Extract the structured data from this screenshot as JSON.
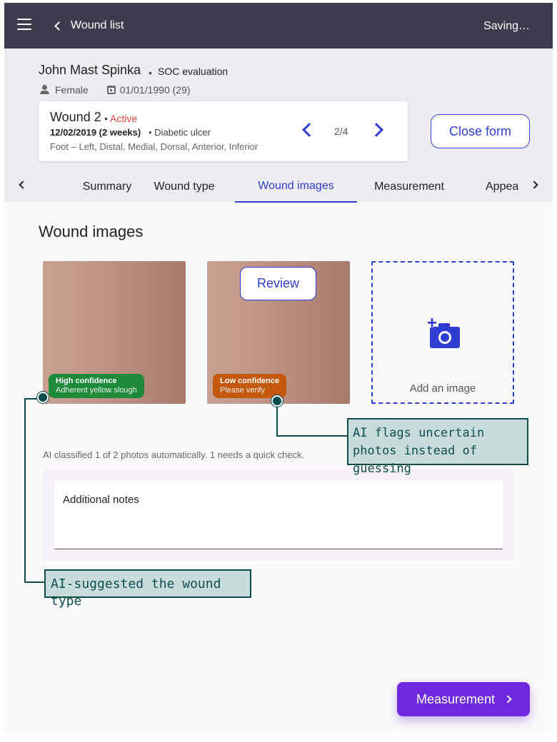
{
  "topbar": {
    "back_label": "Wound list",
    "status": "Saving…"
  },
  "patient": {
    "name": "John Mast Spinka",
    "separator": "•",
    "evaluation": "SOC evaluation",
    "sex": "Female",
    "dob": "01/01/1990 (29)"
  },
  "wound": {
    "title": "Wound 2",
    "separator": "•",
    "status": "Active",
    "date": "12/02/2019 (2 weeks)",
    "kind": "• Diabetic ulcer",
    "location": "Foot – Left, Distal, Medial, Dorsal, Anterior, Inferior",
    "pager": "2/4"
  },
  "actions": {
    "close_form": "Close form",
    "next": "Measurement"
  },
  "tabs": [
    {
      "label": "Summary",
      "active": false
    },
    {
      "label": "Wound type",
      "active": false
    },
    {
      "label": "Wound images",
      "active": true
    },
    {
      "label": "Measurement",
      "active": false
    },
    {
      "label": "Appea",
      "active": false
    }
  ],
  "section": {
    "title": "Wound images",
    "add_image": "Add an image",
    "review": "Review",
    "ai_caption": "AI classified 1 of 2 photos automatically. 1 needs a quick check.",
    "notes_label": "Additional notes"
  },
  "photos": [
    {
      "confidence": "High confidence",
      "detail": "Adherent yellow slough"
    },
    {
      "confidence": "Low confidence",
      "detail": "Please verify"
    }
  ],
  "annotations": {
    "flags": "AI flags uncertain photos instead of guessing",
    "suggested": "AI-suggested the wound type"
  },
  "colors": {
    "accent": "#2f3dd1",
    "primary": "#6d28e0",
    "high_confidence": "#1f8a3b",
    "low_confidence": "#c4580e",
    "active_status": "#e0413b",
    "topbar": "#3b3d4f"
  }
}
